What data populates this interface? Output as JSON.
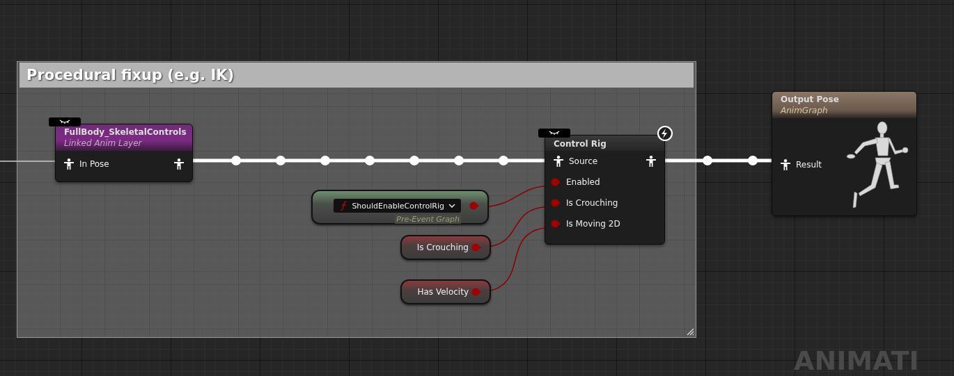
{
  "comment": {
    "title": "Procedural fixup (e.g. IK)"
  },
  "nodes": [
    {
      "kind": "layer",
      "title": "FullBody_SkeletalControls",
      "subtitle": "Linked Anim Layer",
      "pins": [
        {
          "label": "In Pose",
          "kind": "pose"
        }
      ]
    },
    {
      "kind": "function",
      "function": "ShouldEnableControlRig",
      "context": "Pre-Event Graph"
    },
    {
      "kind": "variable",
      "label": "Is Crouching"
    },
    {
      "kind": "variable",
      "label": "Has Velocity"
    },
    {
      "kind": "control_rig",
      "title": "Control Rig",
      "pins": [
        {
          "label": "Source",
          "kind": "pose"
        },
        {
          "label": "Enabled",
          "kind": "bool"
        },
        {
          "label": "Is Crouching",
          "kind": "bool"
        },
        {
          "label": "Is Moving 2D",
          "kind": "bool"
        }
      ]
    },
    {
      "kind": "output",
      "title": "Output Pose",
      "subtitle": "AnimGraph",
      "pins": [
        {
          "label": "Result",
          "kind": "pose"
        }
      ]
    }
  ],
  "graph_label": "ANIMATI"
}
